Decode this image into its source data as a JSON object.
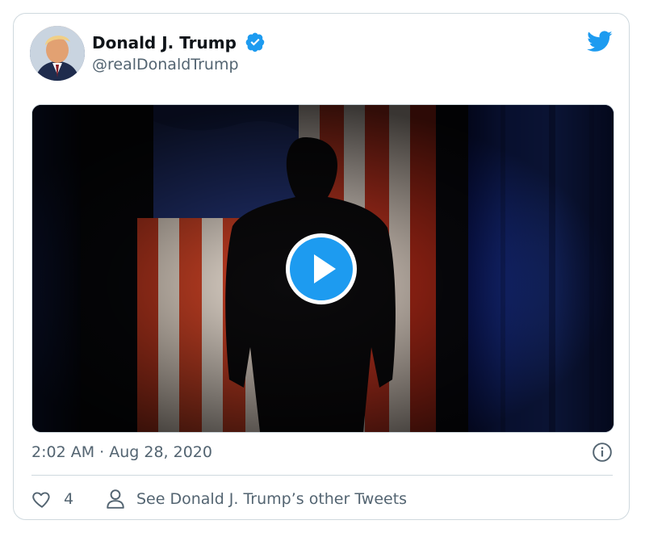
{
  "tweet": {
    "author": {
      "name": "Donald J. Trump",
      "handle": "@realDonaldTrump",
      "verified": true,
      "avatar_icon": "profile-photo"
    },
    "media": {
      "type": "video",
      "play_icon": "play-icon"
    },
    "timestamp": "2:02 AM · Aug 28, 2020",
    "actions": {
      "like_count": "4",
      "other_tweets_label": "See Donald J. Trump’s other Tweets"
    }
  },
  "colors": {
    "twitter_blue": "#1d9bf0",
    "text_primary": "#0f1419",
    "text_secondary": "#536471",
    "border": "#cfd9de"
  },
  "icons": {
    "verified": "verified-badge-icon",
    "logo": "twitter-bird-icon",
    "info": "info-icon",
    "like": "heart-icon",
    "profile": "person-icon"
  }
}
